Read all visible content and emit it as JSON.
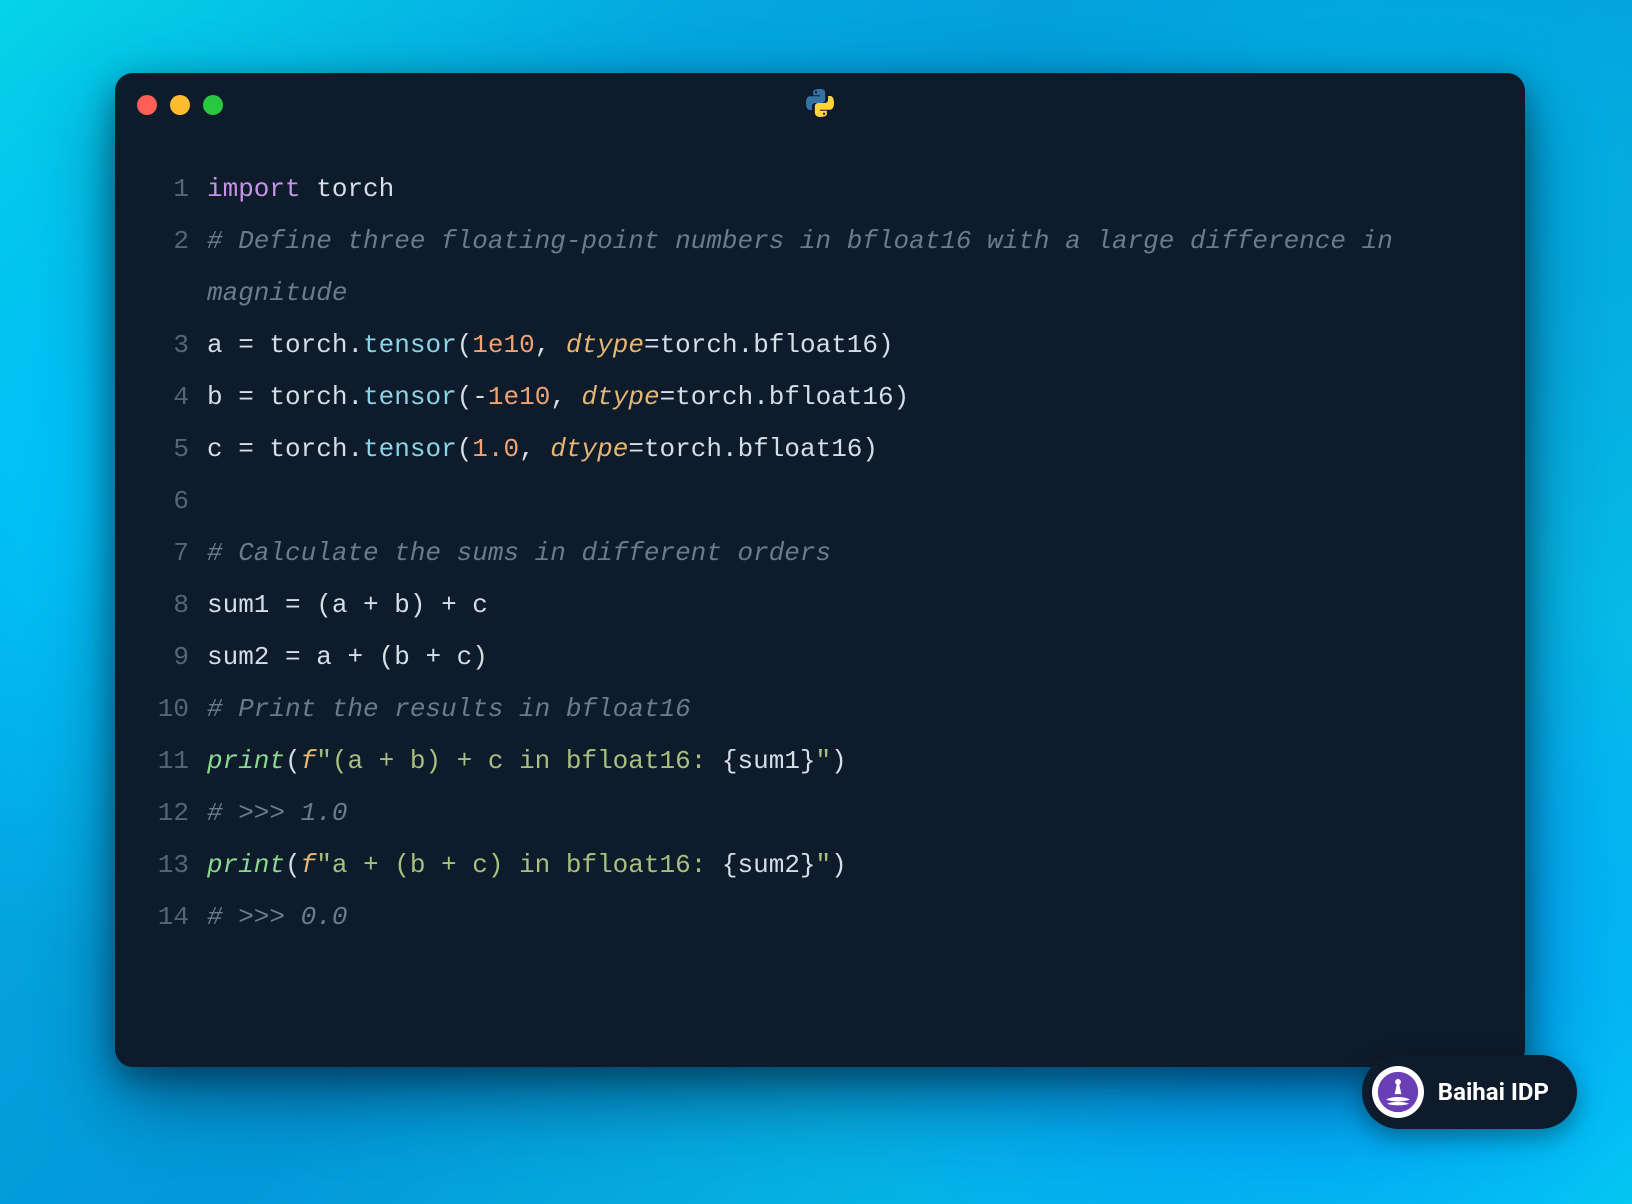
{
  "watermark": {
    "label": "Baihai IDP"
  },
  "language_badge": "python",
  "code": {
    "lines": [
      {
        "n": 1,
        "tokens": [
          {
            "cls": "tok-keyword",
            "t": "import"
          },
          {
            "cls": "tok-op",
            "t": " "
          },
          {
            "cls": "tok-module",
            "t": "torch"
          }
        ]
      },
      {
        "n": 2,
        "tokens": [
          {
            "cls": "tok-comment",
            "t": "# Define three floating-point numbers in bfloat16 with a large difference in magnitude"
          }
        ]
      },
      {
        "n": 3,
        "tokens": [
          {
            "cls": "tok-var",
            "t": "a "
          },
          {
            "cls": "tok-op",
            "t": "="
          },
          {
            "cls": "tok-var",
            "t": " torch"
          },
          {
            "cls": "tok-punct",
            "t": "."
          },
          {
            "cls": "tok-method",
            "t": "tensor"
          },
          {
            "cls": "tok-punct",
            "t": "("
          },
          {
            "cls": "tok-number",
            "t": "1e10"
          },
          {
            "cls": "tok-punct",
            "t": ", "
          },
          {
            "cls": "tok-kwarg",
            "t": "dtype"
          },
          {
            "cls": "tok-op",
            "t": "="
          },
          {
            "cls": "tok-var",
            "t": "torch"
          },
          {
            "cls": "tok-punct",
            "t": "."
          },
          {
            "cls": "tok-var",
            "t": "bfloat16"
          },
          {
            "cls": "tok-punct",
            "t": ")"
          }
        ]
      },
      {
        "n": 4,
        "tokens": [
          {
            "cls": "tok-var",
            "t": "b "
          },
          {
            "cls": "tok-op",
            "t": "="
          },
          {
            "cls": "tok-var",
            "t": " torch"
          },
          {
            "cls": "tok-punct",
            "t": "."
          },
          {
            "cls": "tok-method",
            "t": "tensor"
          },
          {
            "cls": "tok-punct",
            "t": "("
          },
          {
            "cls": "tok-op",
            "t": "-"
          },
          {
            "cls": "tok-number",
            "t": "1e10"
          },
          {
            "cls": "tok-punct",
            "t": ", "
          },
          {
            "cls": "tok-kwarg",
            "t": "dtype"
          },
          {
            "cls": "tok-op",
            "t": "="
          },
          {
            "cls": "tok-var",
            "t": "torch"
          },
          {
            "cls": "tok-punct",
            "t": "."
          },
          {
            "cls": "tok-var",
            "t": "bfloat16"
          },
          {
            "cls": "tok-punct",
            "t": ")"
          }
        ]
      },
      {
        "n": 5,
        "tokens": [
          {
            "cls": "tok-var",
            "t": "c "
          },
          {
            "cls": "tok-op",
            "t": "="
          },
          {
            "cls": "tok-var",
            "t": " torch"
          },
          {
            "cls": "tok-punct",
            "t": "."
          },
          {
            "cls": "tok-method",
            "t": "tensor"
          },
          {
            "cls": "tok-punct",
            "t": "("
          },
          {
            "cls": "tok-number",
            "t": "1.0"
          },
          {
            "cls": "tok-punct",
            "t": ", "
          },
          {
            "cls": "tok-kwarg",
            "t": "dtype"
          },
          {
            "cls": "tok-op",
            "t": "="
          },
          {
            "cls": "tok-var",
            "t": "torch"
          },
          {
            "cls": "tok-punct",
            "t": "."
          },
          {
            "cls": "tok-var",
            "t": "bfloat16"
          },
          {
            "cls": "tok-punct",
            "t": ")"
          }
        ]
      },
      {
        "n": 6,
        "tokens": [
          {
            "cls": "tok-var",
            "t": ""
          }
        ]
      },
      {
        "n": 7,
        "tokens": [
          {
            "cls": "tok-comment",
            "t": "# Calculate the sums in different orders"
          }
        ]
      },
      {
        "n": 8,
        "tokens": [
          {
            "cls": "tok-var",
            "t": "sum1 "
          },
          {
            "cls": "tok-op",
            "t": "="
          },
          {
            "cls": "tok-var",
            "t": " (a "
          },
          {
            "cls": "tok-op",
            "t": "+"
          },
          {
            "cls": "tok-var",
            "t": " b) "
          },
          {
            "cls": "tok-op",
            "t": "+"
          },
          {
            "cls": "tok-var",
            "t": " c"
          }
        ]
      },
      {
        "n": 9,
        "tokens": [
          {
            "cls": "tok-var",
            "t": "sum2 "
          },
          {
            "cls": "tok-op",
            "t": "="
          },
          {
            "cls": "tok-var",
            "t": " a "
          },
          {
            "cls": "tok-op",
            "t": "+"
          },
          {
            "cls": "tok-var",
            "t": " (b "
          },
          {
            "cls": "tok-op",
            "t": "+"
          },
          {
            "cls": "tok-var",
            "t": " c)"
          }
        ]
      },
      {
        "n": 10,
        "tokens": [
          {
            "cls": "tok-comment",
            "t": "# Print the results in bfloat16"
          }
        ]
      },
      {
        "n": 11,
        "tokens": [
          {
            "cls": "tok-builtin",
            "t": "print"
          },
          {
            "cls": "tok-punct",
            "t": "("
          },
          {
            "cls": "tok-fprefix",
            "t": "f"
          },
          {
            "cls": "tok-string",
            "t": "\"(a + b) + c in bfloat16: "
          },
          {
            "cls": "tok-interp",
            "t": "{sum1}"
          },
          {
            "cls": "tok-string",
            "t": "\""
          },
          {
            "cls": "tok-punct",
            "t": ")"
          }
        ]
      },
      {
        "n": 12,
        "tokens": [
          {
            "cls": "tok-comment",
            "t": "# >>> 1.0"
          }
        ]
      },
      {
        "n": 13,
        "tokens": [
          {
            "cls": "tok-builtin",
            "t": "print"
          },
          {
            "cls": "tok-punct",
            "t": "("
          },
          {
            "cls": "tok-fprefix",
            "t": "f"
          },
          {
            "cls": "tok-string",
            "t": "\"a + (b + c) in bfloat16: "
          },
          {
            "cls": "tok-interp",
            "t": "{sum2}"
          },
          {
            "cls": "tok-string",
            "t": "\""
          },
          {
            "cls": "tok-punct",
            "t": ")"
          }
        ]
      },
      {
        "n": 14,
        "tokens": [
          {
            "cls": "tok-comment",
            "t": "# >>> 0.0"
          }
        ]
      }
    ]
  }
}
